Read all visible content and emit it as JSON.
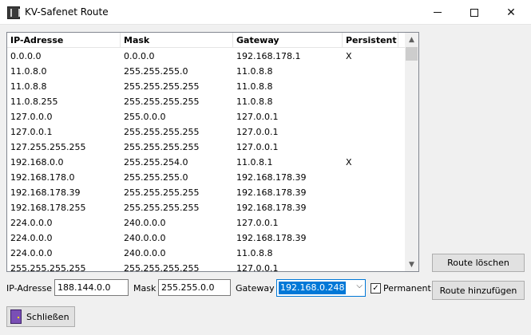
{
  "window": {
    "title": "KV-Safenet Route",
    "minimize": "—",
    "maximize": "",
    "close": "✕"
  },
  "table": {
    "headers": [
      "IP-Adresse",
      "Mask",
      "Gateway",
      "Persistent"
    ],
    "rows": [
      [
        "0.0.0.0",
        "0.0.0.0",
        "192.168.178.1",
        "X"
      ],
      [
        "11.0.8.0",
        "255.255.255.0",
        "11.0.8.8",
        ""
      ],
      [
        "11.0.8.8",
        "255.255.255.255",
        "11.0.8.8",
        ""
      ],
      [
        "11.0.8.255",
        "255.255.255.255",
        "11.0.8.8",
        ""
      ],
      [
        "127.0.0.0",
        "255.0.0.0",
        "127.0.0.1",
        ""
      ],
      [
        "127.0.0.1",
        "255.255.255.255",
        "127.0.0.1",
        ""
      ],
      [
        "127.255.255.255",
        "255.255.255.255",
        "127.0.0.1",
        ""
      ],
      [
        "192.168.0.0",
        "255.255.254.0",
        "11.0.8.1",
        "X"
      ],
      [
        "192.168.178.0",
        "255.255.255.0",
        "192.168.178.39",
        ""
      ],
      [
        "192.168.178.39",
        "255.255.255.255",
        "192.168.178.39",
        ""
      ],
      [
        "192.168.178.255",
        "255.255.255.255",
        "192.168.178.39",
        ""
      ],
      [
        "224.0.0.0",
        "240.0.0.0",
        "127.0.0.1",
        ""
      ],
      [
        "224.0.0.0",
        "240.0.0.0",
        "192.168.178.39",
        ""
      ],
      [
        "224.0.0.0",
        "240.0.0.0",
        "11.0.8.8",
        ""
      ],
      [
        "255.255.255.255",
        "255.255.255.255",
        "127.0.0.1",
        ""
      ]
    ]
  },
  "form": {
    "ip_label": "IP-Adresse",
    "ip_value": "188.144.0.0",
    "mask_label": "Mask",
    "mask_value": "255.255.0.0",
    "gateway_label": "Gateway",
    "gateway_value": "192.168.0.248",
    "permanent_label": "Permanent",
    "permanent_checked": true
  },
  "buttons": {
    "delete_route": "Route löschen",
    "add_route": "Route hinzufügen",
    "close": "Schließen"
  },
  "icons": {
    "app": "app-icon",
    "close_button": "door-icon",
    "scroll_up": "▲",
    "scroll_down": "▼",
    "combo_arrow": "⌵",
    "check": "✓"
  },
  "colors": {
    "selection": "#0078d7",
    "window_bg": "#f0f0f0"
  }
}
